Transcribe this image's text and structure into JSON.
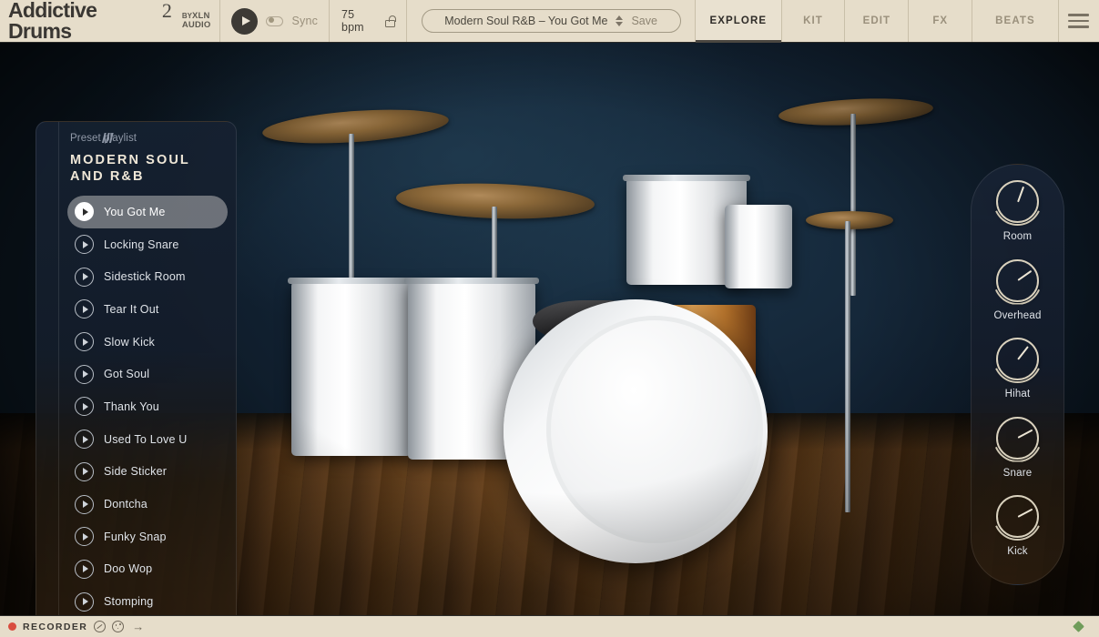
{
  "app": {
    "logo_main": "Addictive Drums",
    "logo_version": "2",
    "by_prefix": "BY",
    "by_brand": "XLN",
    "by_brand2": "AUDIO"
  },
  "transport": {
    "play_icon": "play-icon",
    "sync_label": "Sync",
    "sync_on": false,
    "tempo": "75 bpm",
    "lock_icon": "unlocked-padlock-icon"
  },
  "preset": {
    "name": "Modern Soul R&B – You Got Me",
    "stepper_icon": "up-down-chevron-icon",
    "save_label": "Save"
  },
  "nav": {
    "tabs": [
      {
        "label": "EXPLORE",
        "active": true
      },
      {
        "label": "KIT",
        "active": false
      },
      {
        "label": "EDIT",
        "active": false
      },
      {
        "label": "FX",
        "active": false
      },
      {
        "label": "BEATS",
        "active": false
      }
    ],
    "menu_icon": "hamburger-menu-icon"
  },
  "playlist": {
    "handle_icon": "playlist-handle-icon",
    "kicker": "Preset playlist",
    "title": "MODERN SOUL AND R&B",
    "items": [
      {
        "label": "You Got Me",
        "selected": true
      },
      {
        "label": "Locking Snare",
        "selected": false
      },
      {
        "label": "Sidestick Room",
        "selected": false
      },
      {
        "label": "Tear It Out",
        "selected": false
      },
      {
        "label": "Slow Kick",
        "selected": false
      },
      {
        "label": "Got Soul",
        "selected": false
      },
      {
        "label": "Thank You",
        "selected": false
      },
      {
        "label": "Used To Love U",
        "selected": false
      },
      {
        "label": "Side Sticker",
        "selected": false
      },
      {
        "label": "Dontcha",
        "selected": false
      },
      {
        "label": "Funky Snap",
        "selected": false
      },
      {
        "label": "Doo Wop",
        "selected": false
      },
      {
        "label": "Stomping",
        "selected": false
      }
    ]
  },
  "mixer": {
    "knobs": [
      {
        "label": "Room",
        "angle": 20
      },
      {
        "label": "Overhead",
        "angle": 55
      },
      {
        "label": "Hihat",
        "angle": 38
      },
      {
        "label": "Snare",
        "angle": 62
      },
      {
        "label": "Kick",
        "angle": 62
      }
    ]
  },
  "recorder": {
    "record_icon": "record-dot-icon",
    "label": "RECORDER",
    "icon1": "no-entry-circle-icon",
    "icon2": "dice-circle-icon",
    "arrow_icon": "arrow-right-icon",
    "status_icon": "green-diamond-indicator"
  },
  "colors": {
    "toolbar_bg": "#e6ddca",
    "accent_record": "#d94d3f",
    "status_green": "#6f9c5a",
    "panel_navy": "#162131"
  }
}
